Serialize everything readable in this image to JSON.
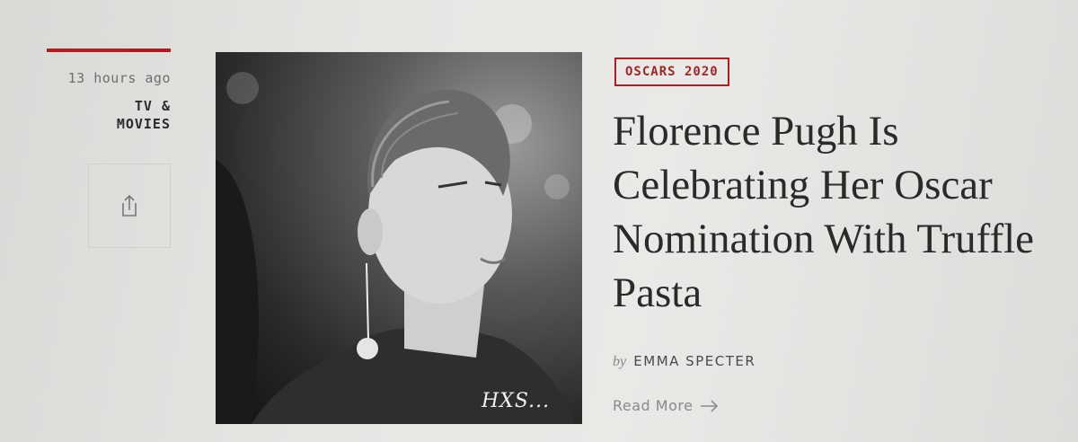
{
  "sidebar": {
    "timestamp": "13 hours ago",
    "category": "TV &\nMOVIES",
    "share_icon": "share-icon"
  },
  "article": {
    "tag": "OSCARS 2020",
    "headline": "Florence Pugh Is Celebrating Her Oscar Nomination With Truffle Pasta",
    "byline_prefix": "by",
    "author": "EMMA SPECTER",
    "read_more": "Read More",
    "read_more_icon": "arrow-right-icon"
  },
  "image": {
    "watermark": "HXS..."
  },
  "colors": {
    "accent": "#b01e23",
    "text": "#2a2a2a",
    "muted": "#8a8a8a"
  }
}
